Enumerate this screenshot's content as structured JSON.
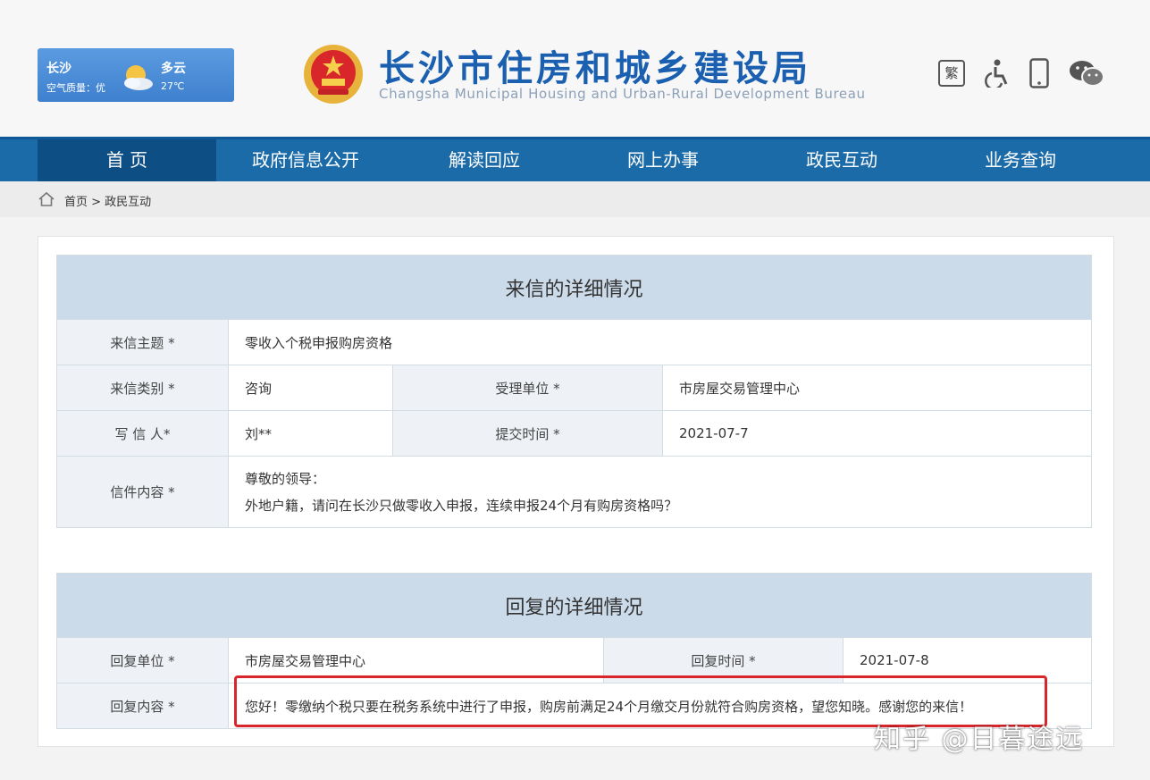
{
  "weather": {
    "city": "长沙",
    "air_quality": "空气质量：优",
    "condition": "多云",
    "temperature": "27℃"
  },
  "site": {
    "title_cn": "长沙市住房和城乡建设局",
    "title_en": "Changsha Municipal Housing and Urban-Rural Development Bureau",
    "traditional_label": "繁"
  },
  "nav": {
    "items": [
      "首 页",
      "政府信息公开",
      "解读回应",
      "网上办事",
      "政民互动",
      "业务查询"
    ]
  },
  "breadcrumb": "首页 > 政民互动",
  "letter": {
    "header": "来信的详细情况",
    "subject_label": "来信主题 *",
    "subject": "零收入个税申报购房资格",
    "category_label": "来信类别 *",
    "category": "咨询",
    "dept_label": "受理单位 *",
    "dept": "市房屋交易管理中心",
    "writer_label": "写 信 人*",
    "writer": "刘**",
    "submit_time_label": "提交时间 *",
    "submit_time": "2021-07-7",
    "content_label": "信件内容 *",
    "content_line1": "尊敬的领导：",
    "content_line2": "外地户籍，请问在长沙只做零收入申报，连续申报24个月有购房资格吗？"
  },
  "reply": {
    "header": "回复的详细情况",
    "unit_label": "回复单位 *",
    "unit": "市房屋交易管理中心",
    "time_label": "回复时间 *",
    "time": "2021-07-8",
    "content_label": "回复内容 *",
    "content": "您好！零缴纳个税只要在税务系统中进行了申报，购房前满足24个月缴交月份就符合购房资格，望您知晓。感谢您的来信！"
  },
  "watermark": "知乎 @日暮途远",
  "colors": {
    "nav": "#1c6ba9",
    "nav_active": "#0d4f85",
    "table_header": "#ccdbea",
    "highlight": "#d9262c",
    "title": "#1a5fb0"
  }
}
